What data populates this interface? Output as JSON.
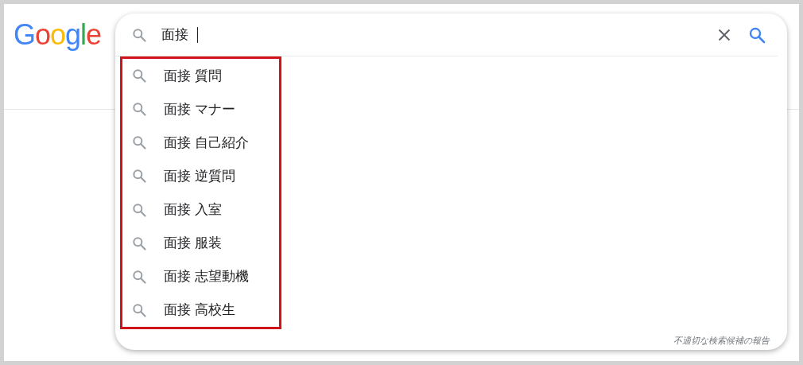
{
  "logo": {
    "letters": [
      {
        "text": "G",
        "color": "#4285f4"
      },
      {
        "text": "o",
        "color": "#ea4335"
      },
      {
        "text": "o",
        "color": "#fbbc05"
      },
      {
        "text": "g",
        "color": "#4285f4"
      },
      {
        "text": "l",
        "color": "#34a853"
      },
      {
        "text": "e",
        "color": "#ea4335"
      }
    ]
  },
  "search": {
    "value": "面接 "
  },
  "suggestions": {
    "highlighted": true,
    "items": [
      {
        "text": "面接 質問"
      },
      {
        "text": "面接 マナー"
      },
      {
        "text": "面接 自己紹介"
      },
      {
        "text": "面接 逆質問"
      },
      {
        "text": "面接 入室"
      },
      {
        "text": "面接 服装"
      },
      {
        "text": "面接 志望動機"
      },
      {
        "text": "面接 高校生"
      }
    ]
  },
  "report_link": "不適切な検索候補の報告"
}
